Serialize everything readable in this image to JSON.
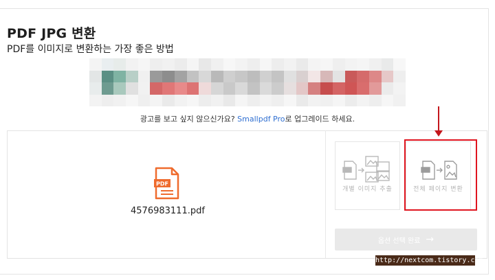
{
  "page": {
    "title": "PDF JPG 변환",
    "subtitle": "PDF를 이미지로 변환하는 가장 좋은 방법"
  },
  "promo": {
    "before": "광고를 보고 싶지 않으신가요? ",
    "link": "Smallpdf Pro",
    "after": "로 업그레이드 하세요."
  },
  "file": {
    "name": "4576983111.pdf",
    "icon": "pdf-file-icon",
    "icon_label": "PDF"
  },
  "options": [
    {
      "label": "개별 이미지 추출",
      "icon": "extract-images-icon"
    },
    {
      "label": "전체 페이지 변환",
      "icon": "convert-pages-icon"
    }
  ],
  "confirm_button": {
    "label": "옵션 선택 완료",
    "icon": "arrow-right-icon"
  },
  "watermark": "http://nextcom.tistory.com",
  "colors": {
    "pdf_orange": "#ef6b2d",
    "link_blue": "#2f6fd1",
    "highlight_red": "#e0141e",
    "disabled_button": "#e9e9e9"
  }
}
